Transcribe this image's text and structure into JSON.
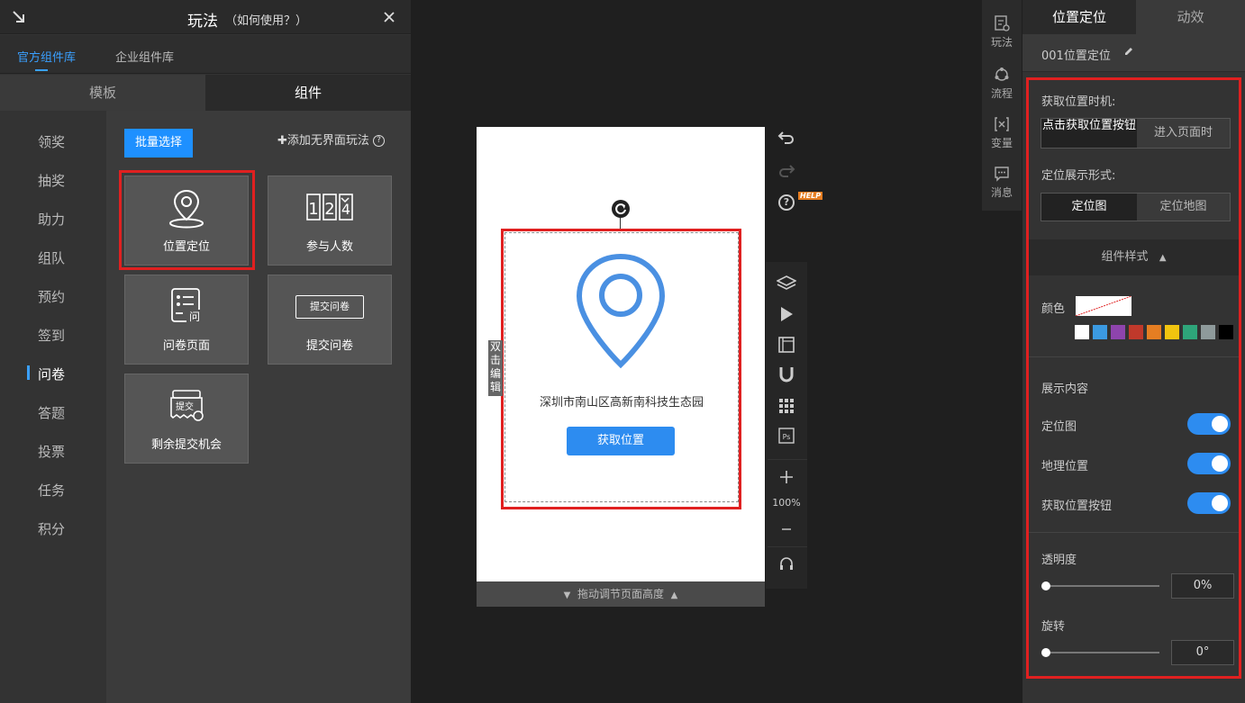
{
  "left_panel": {
    "title": "玩法",
    "subtitle": "（如何使用？）",
    "library_tabs": [
      "官方组件库",
      "企业组件库"
    ],
    "mode_tabs": [
      "模板",
      "组件"
    ],
    "categories": [
      "领奖",
      "抽奖",
      "助力",
      "组队",
      "预约",
      "签到",
      "问卷",
      "答题",
      "投票",
      "任务",
      "积分"
    ],
    "active_category": "问卷",
    "batch_select": "批量选择",
    "add_no_ui": "添加无界面玩法",
    "components": [
      {
        "label": "位置定位",
        "icon": "location-pin-icon"
      },
      {
        "label": "参与人数",
        "icon": "counter-icon"
      },
      {
        "label": "问卷页面",
        "icon": "questionnaire-icon"
      },
      {
        "label": "提交问卷",
        "icon": "submit-button-icon"
      },
      {
        "label": "剩余提交机会",
        "icon": "submit-chance-icon"
      }
    ],
    "submit_icon_text": "提交问卷",
    "chance_icon_text": "提交"
  },
  "canvas": {
    "address": "深圳市南山区高新南科技生态园",
    "get_location_button": "获取位置",
    "double_click_edit": "双击编辑",
    "drag_height": "拖动调节页面高度",
    "zoom": "100%",
    "help_badge": "HELP"
  },
  "vertical_tabs": [
    "玩法",
    "流程",
    "变量",
    "消息"
  ],
  "right_panel": {
    "tabs": [
      "位置定位",
      "动效"
    ],
    "component_name": "001位置定位",
    "timing_label": "获取位置时机:",
    "timing_options": [
      "点击获取位置按钮",
      "进入页面时"
    ],
    "display_label": "定位展示形式:",
    "display_options": [
      "定位图",
      "定位地图"
    ],
    "style_header": "组件样式",
    "color_label": "颜色",
    "swatches": [
      "#ffffff",
      "#3b9ae1",
      "#8e44ad",
      "#c0392b",
      "#e67e22",
      "#f1c40f",
      "#2ea57a",
      "#8e9a9b",
      "#000000"
    ],
    "show_content_label": "展示内容",
    "toggles": [
      {
        "label": "定位图",
        "on": true
      },
      {
        "label": "地理位置",
        "on": true
      },
      {
        "label": "获取位置按钮",
        "on": true
      }
    ],
    "opacity_label": "透明度",
    "opacity_value": "0%",
    "rotate_label": "旋转",
    "rotate_value": "0°"
  },
  "colors": {
    "accent": "#2d8cf0",
    "highlight": "#e02020",
    "pin": "#4a90e2"
  }
}
